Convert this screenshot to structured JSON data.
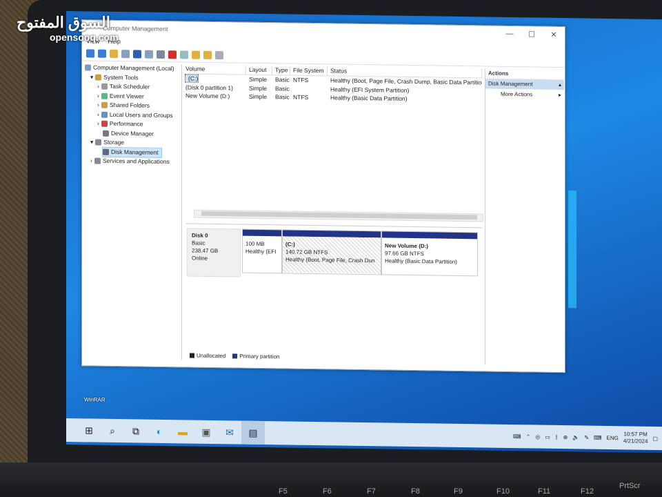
{
  "watermark": {
    "arabic": "السوق المفتوح",
    "latin": "opensooq.com"
  },
  "window": {
    "title": "Computer Management",
    "menu": [
      "View",
      "Help"
    ],
    "controls": [
      "—",
      "☐",
      "✕"
    ]
  },
  "tree": [
    "Computer Management (Local)",
    "System Tools",
    "Task Scheduler",
    "Event Viewer",
    "Shared Folders",
    "Local Users and Groups",
    "Performance",
    "Device Manager",
    "Storage",
    "Disk Management",
    "Services and Applications"
  ],
  "volumes": {
    "headers": [
      "Volume",
      "Layout",
      "Type",
      "File System",
      "Status"
    ],
    "rows": [
      [
        "(C:)",
        "Simple",
        "Basic",
        "NTFS",
        "Healthy (Boot, Page File, Crash Dump, Basic Data Partition"
      ],
      [
        "(Disk 0 partition 1)",
        "Simple",
        "Basic",
        "",
        "Healthy (EFI System Partition)"
      ],
      [
        "New Volume (D:)",
        "Simple",
        "Basic",
        "NTFS",
        "Healthy (Basic Data Partition)"
      ]
    ]
  },
  "disk": {
    "name": "Disk 0",
    "type": "Basic",
    "size": "238.47 GB",
    "state": "Online",
    "partitions": [
      {
        "title": "",
        "size": "100 MB",
        "status": "Healthy (EFI"
      },
      {
        "title": "(C:)",
        "size": "140.72 GB NTFS",
        "status": "Healthy (Boot, Page File, Crash Dun"
      },
      {
        "title": "New Volume  (D:)",
        "size": "97.66 GB NTFS",
        "status": "Healthy (Basic Data Partition)"
      }
    ]
  },
  "legend": [
    "Unallocated",
    "Primary partition"
  ],
  "actions": {
    "header": "Actions",
    "selected": "Disk Management",
    "more": "More Actions"
  },
  "desktop": {
    "winrar_label": "WinRAR"
  },
  "taskbar": {
    "lang": "ENG",
    "time": "10:57 PM",
    "date": "4/21/2024"
  },
  "keyboard": [
    "F5",
    "F6",
    "F7",
    "F8",
    "F9",
    "F10",
    "F11",
    "F12",
    "PrtScr"
  ],
  "colors": {
    "primary_partition": "#223388",
    "desktop": "#1e88e5",
    "taskbar": "#d9e6f4"
  }
}
